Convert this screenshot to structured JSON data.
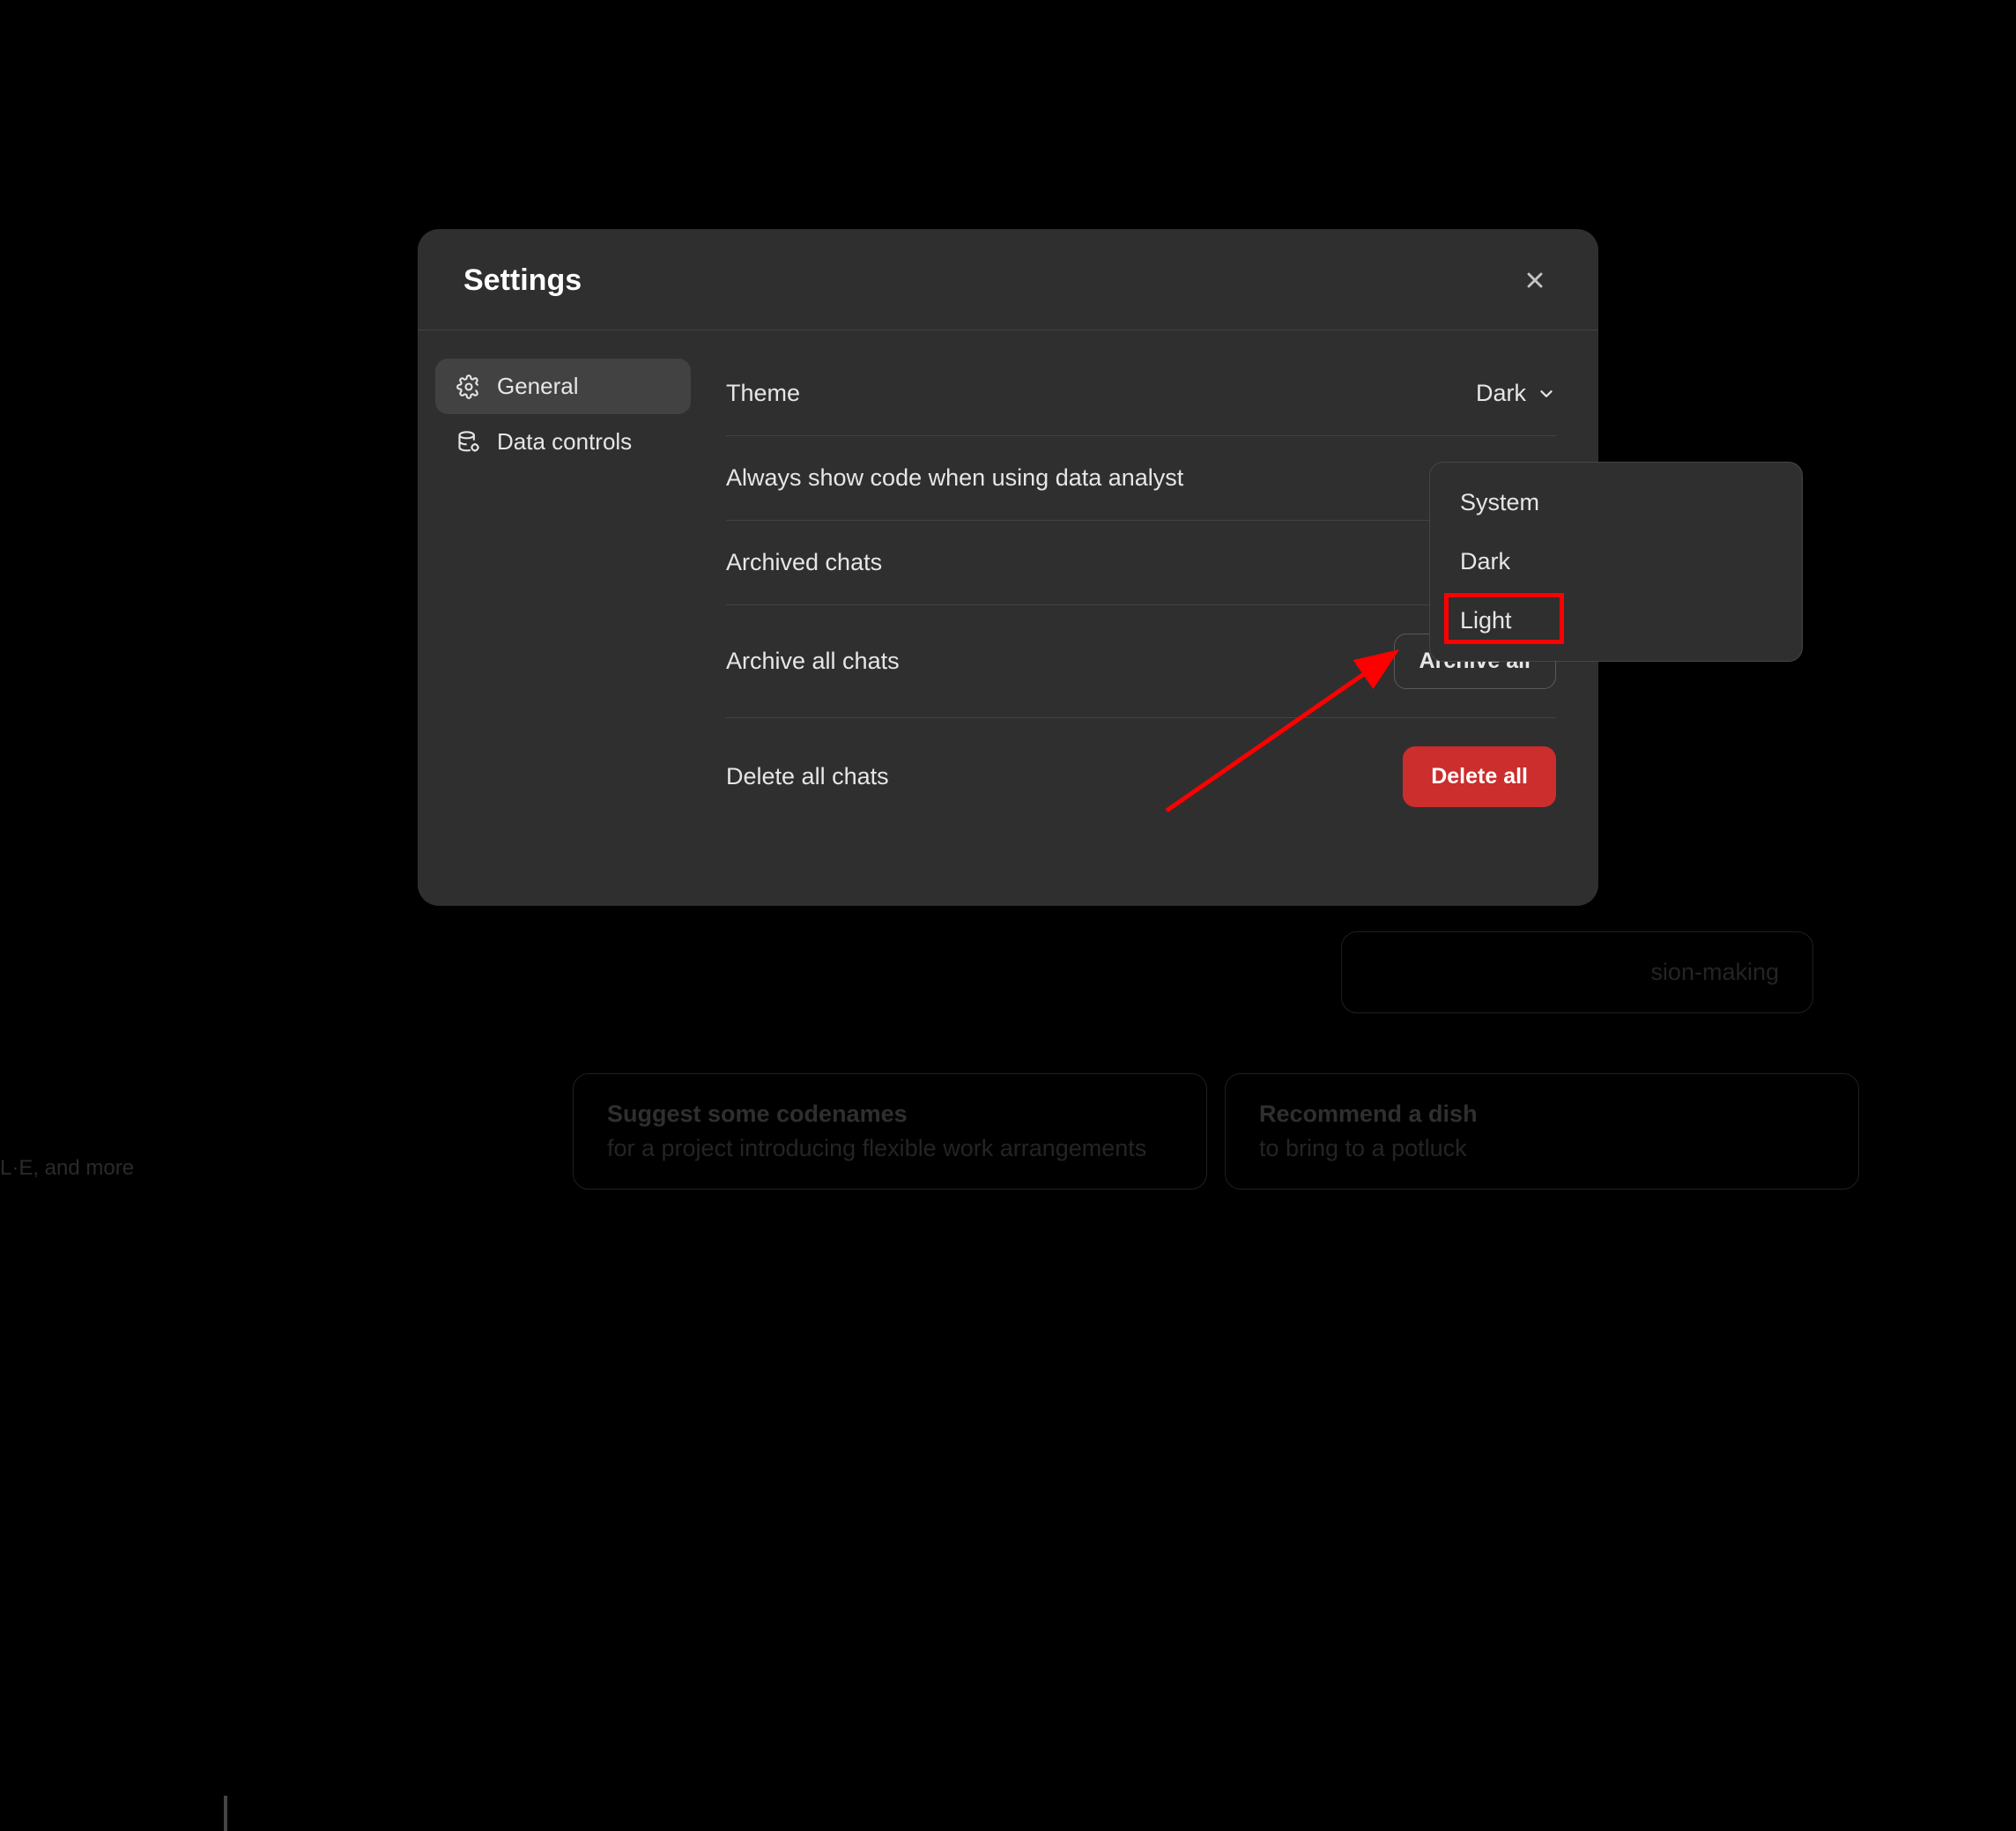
{
  "modal": {
    "title": "Settings"
  },
  "sidebar": {
    "items": [
      {
        "label": "General",
        "active": true
      },
      {
        "label": "Data controls",
        "active": false
      }
    ]
  },
  "settings": {
    "theme": {
      "label": "Theme",
      "value": "Dark",
      "options": [
        "System",
        "Dark",
        "Light"
      ]
    },
    "code_analyst": {
      "label": "Always show code when using data analyst"
    },
    "archived_chats": {
      "label": "Archived chats"
    },
    "archive_all": {
      "label": "Archive all chats",
      "button": "Archive all"
    },
    "delete_all": {
      "label": "Delete all chats",
      "button": "Delete all"
    }
  },
  "background": {
    "footer_partial": "L·E, and more",
    "partial_card_text": "sion-making",
    "cards": [
      {
        "title": "Suggest some codenames",
        "subtitle": "for a project introducing flexible work arrangements"
      },
      {
        "title": "Recommend a dish",
        "subtitle": "to bring to a potluck"
      }
    ]
  }
}
